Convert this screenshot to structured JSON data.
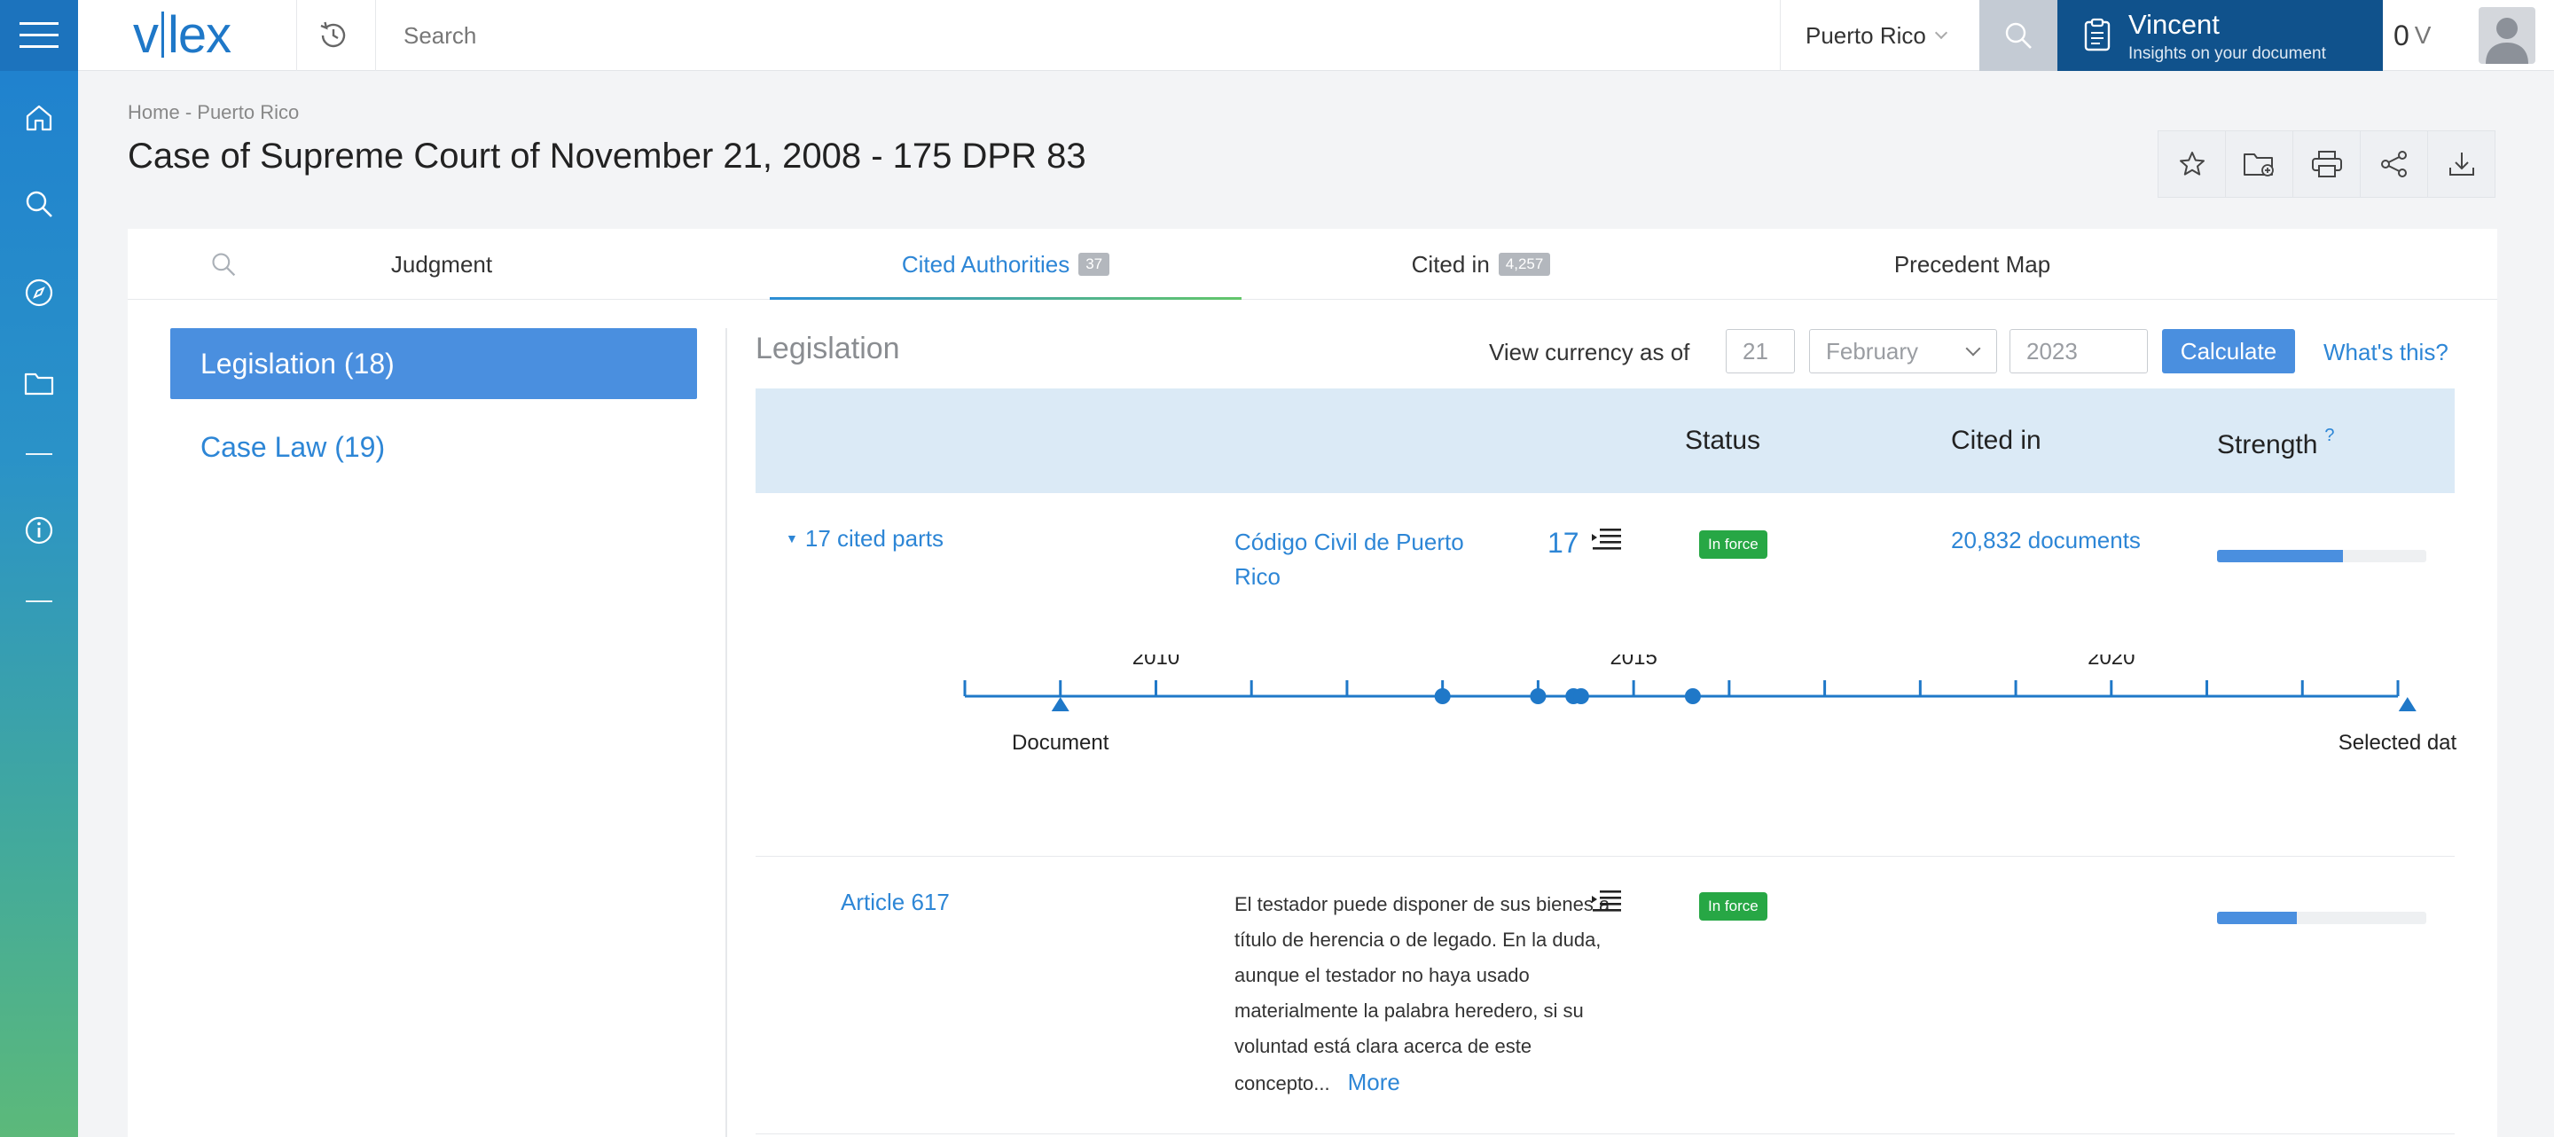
{
  "app": {
    "logo_left": "v",
    "logo_right": "lex"
  },
  "search": {
    "placeholder": "Search"
  },
  "jurisdiction": {
    "selected": "Puerto Rico"
  },
  "vincent": {
    "name": "Vincent",
    "subtitle": "Insights on your document"
  },
  "credits": {
    "value": "0",
    "unit": "V"
  },
  "breadcrumb": {
    "items": [
      "Home",
      "Puerto Rico"
    ],
    "separator": "-"
  },
  "page": {
    "title": "Case of Supreme Court of November 21, 2008 - 175 DPR 83"
  },
  "tabs": [
    {
      "label": "Judgment",
      "badge": ""
    },
    {
      "label": "Cited Authorities",
      "badge": "37",
      "active": true
    },
    {
      "label": "Cited in",
      "badge": "4,257"
    },
    {
      "label": "Precedent Map",
      "badge": ""
    }
  ],
  "sidebar": {
    "categories": [
      {
        "label": "Legislation (18)",
        "active": true
      },
      {
        "label": "Case Law (19)",
        "active": false
      }
    ]
  },
  "legislation": {
    "title": "Legislation",
    "currency": {
      "label": "View currency as of",
      "day_placeholder": "21",
      "month": "February",
      "year_placeholder": "2023",
      "calculate_label": "Calculate",
      "help_label": "What's this?"
    },
    "columns": {
      "status": "Status",
      "cited_in": "Cited in",
      "strength": "Strength",
      "strength_help": "?"
    },
    "rows": [
      {
        "parts_label": "17 cited parts",
        "name": "Código Civil de Puerto Rico",
        "count": "17",
        "status": "In force",
        "cited_in": "20,832 documents",
        "strength": 0.6
      },
      {
        "name": "Article 617",
        "excerpt": "El testador puede disponer de sus bienes a título de herencia o de legado. En la duda, aunque el testador no haya usado materialmente la palabra heredero, si su voluntad está clara acerca de este concepto...",
        "more_label": "More",
        "status": "In force",
        "strength": 0.38
      }
    ],
    "timeline": {
      "year_labels": [
        "2010",
        "2015",
        "2020"
      ],
      "start_label": "Document",
      "end_label": "Selected dat",
      "citation_years": [
        2013.0,
        2014.0,
        2014.37,
        2014.45,
        2015.62
      ],
      "document_year": 2009.0,
      "selected_year": 2023.1,
      "axis_start": 2008.0,
      "axis_end": 2023.0
    }
  },
  "colors": {
    "accent": "#2d86d6",
    "brand_dark": "#10528c",
    "in_force": "#27a745"
  }
}
